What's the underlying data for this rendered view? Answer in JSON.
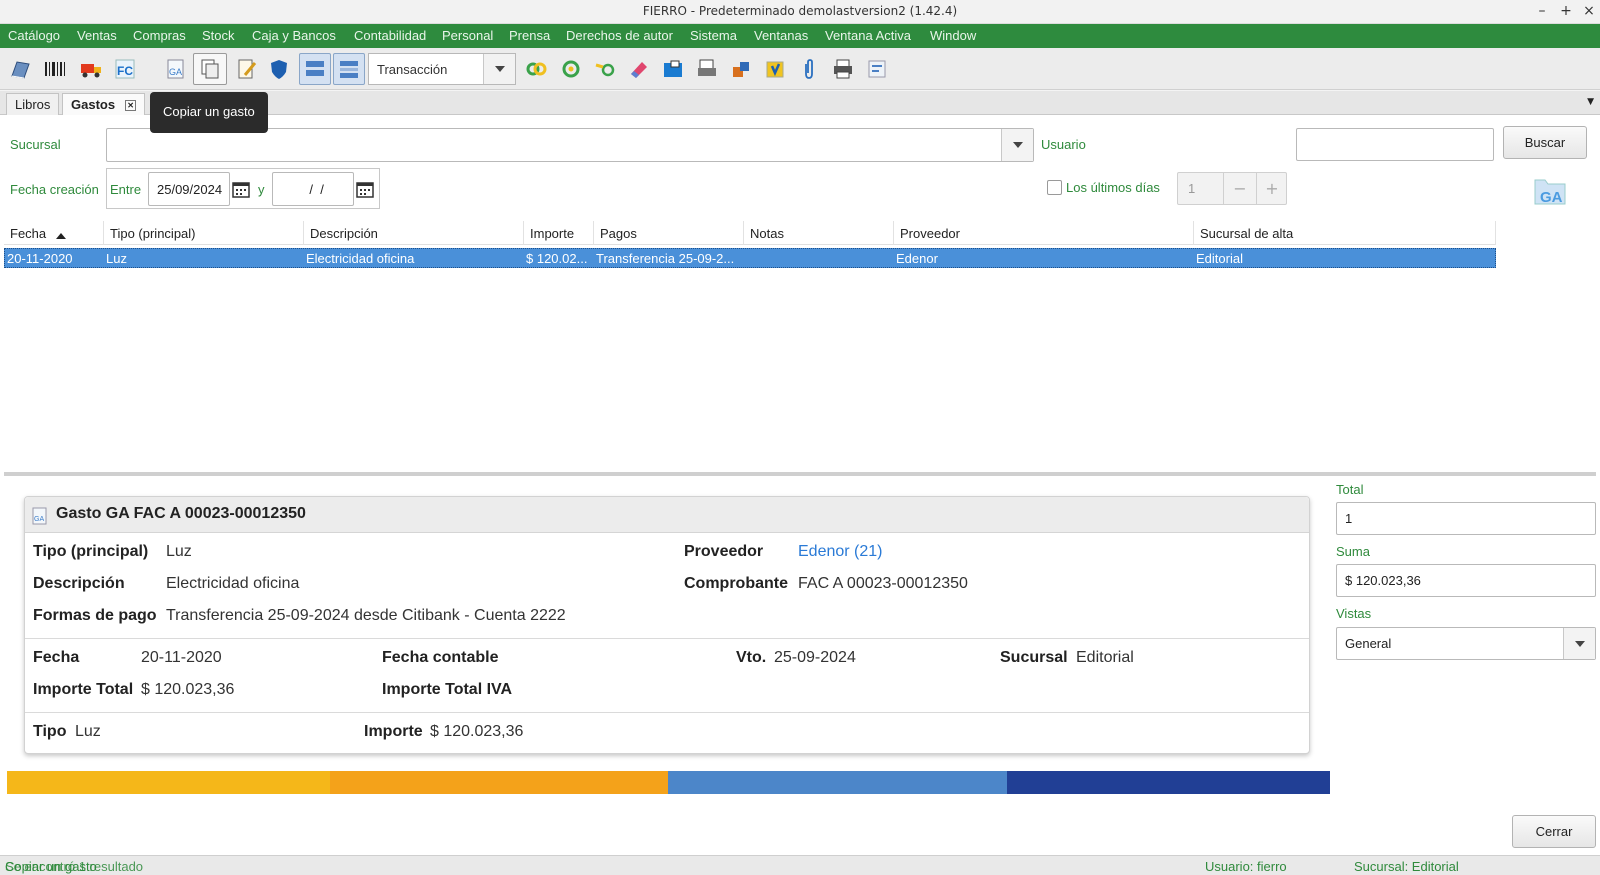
{
  "window": {
    "title": "FIERRO - Predeterminado demolastversion2 (1.42.4)",
    "minimize": "–",
    "maximize": "+",
    "close": "×"
  },
  "menu": [
    "Catálogo",
    "Ventas",
    "Compras",
    "Stock",
    "Caja y Bancos",
    "Contabilidad",
    "Personal",
    "Prensa",
    "Derechos de autor",
    "Sistema",
    "Ventanas",
    "Ventana Activa",
    "Window"
  ],
  "toolbar": {
    "transaction_combo": "Transacción"
  },
  "tabs": {
    "libros": "Libros",
    "gastos": "Gastos"
  },
  "tooltip": "Copiar un gasto",
  "filters": {
    "sucursal_label": "Sucursal",
    "usuario_label": "Usuario",
    "buscar": "Buscar",
    "fecha_label": "Fecha creación",
    "entre": "Entre",
    "date_from": "25/09/2024",
    "y": "y",
    "date_to": "  /  /",
    "last_days_label": "Los últimos días",
    "last_days_value": "1",
    "minus": "−",
    "plus": "+",
    "ga_logo": "GA"
  },
  "table": {
    "columns": [
      "Fecha",
      "Tipo (principal)",
      "Descripción",
      "Importe",
      "Pagos",
      "Notas",
      "Proveedor",
      "Sucursal de alta"
    ],
    "rows": [
      [
        "20-11-2020",
        "Luz",
        "Electricidad oficina",
        "$ 120.02...",
        "Transferencia 25-09-2...",
        "",
        "Edenor",
        "Editorial"
      ]
    ]
  },
  "detail": {
    "title": "Gasto GA FAC A 00023-00012350",
    "tipo_k": "Tipo (principal)",
    "tipo_v": "Luz",
    "desc_k": "Descripción",
    "desc_v": "Electricidad oficina",
    "formas_k": "Formas de pago",
    "formas_v": "Transferencia 25-09-2024 desde Citibank - Cuenta 2222",
    "prov_k": "Proveedor",
    "prov_v": "Edenor (21)",
    "comp_k": "Comprobante",
    "comp_v": "FAC A 00023-00012350",
    "fecha_k": "Fecha",
    "fecha_v": "20-11-2020",
    "fcont_k": "Fecha contable",
    "vto_k": "Vto.",
    "vto_v": "25-09-2024",
    "suc_k": "Sucursal",
    "suc_v": "Editorial",
    "imp_k": "Importe Total",
    "imp_v": "$ 120.023,36",
    "iva_k": "Importe Total IVA",
    "tipo2_k": "Tipo",
    "tipo2_v": "Luz",
    "imp2_k": "Importe",
    "imp2_v": "$ 120.023,36"
  },
  "strip_colors": [
    "#f5b719",
    "#f4a21a",
    "#4c86c9",
    "#213f95"
  ],
  "side": {
    "total_label": "Total",
    "total_value": "1",
    "suma_label": "Suma",
    "suma_value": "$ 120.023,36",
    "vistas_label": "Vistas",
    "vistas_value": "General",
    "cerrar": "Cerrar"
  },
  "status": {
    "left": "Copiar un gasto",
    "left2": "Se encontró 1 resultado",
    "usuario": "Usuario: fierro",
    "sucursal": "Sucursal: Editorial"
  }
}
